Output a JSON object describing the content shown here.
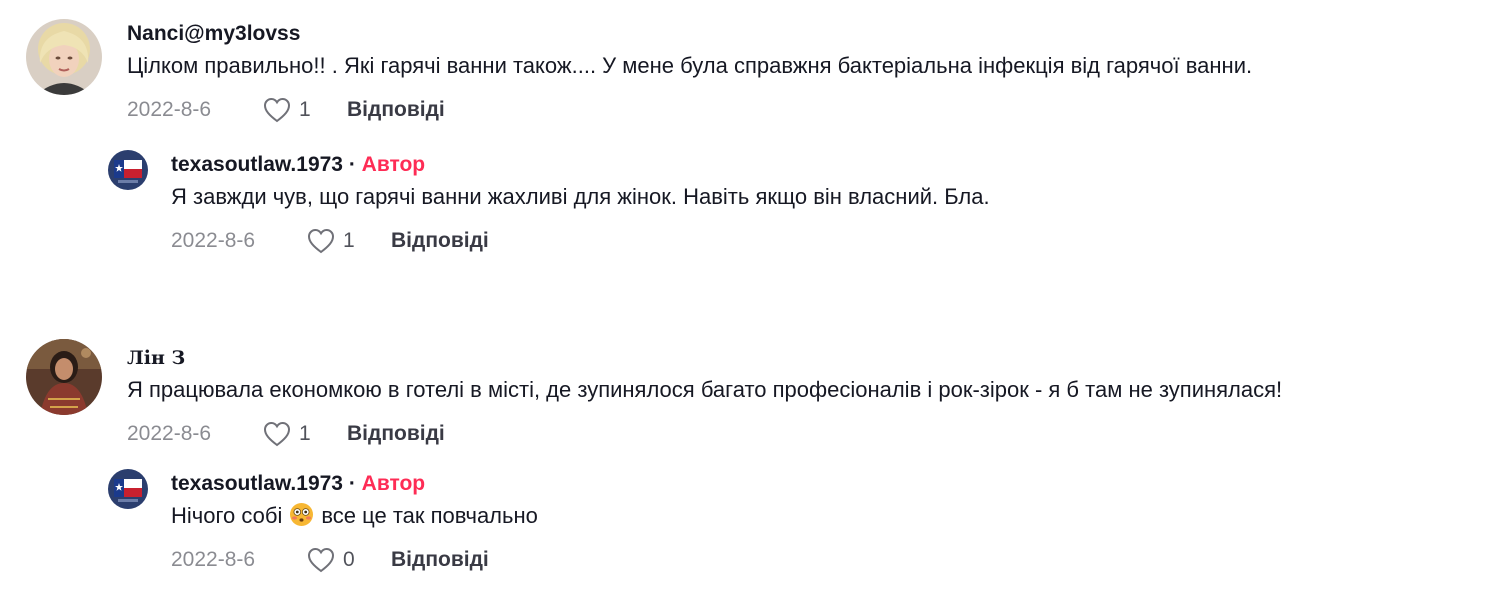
{
  "comments": [
    {
      "username": "Nanci@my3lovss",
      "text": "Цілком правильно!! . Які гарячі ванни також.... У мене була справжня бактеріальна інфекція від гарячої ванни.",
      "date": "2022-8-6",
      "likes": "1",
      "reply_label": "Відповіді",
      "avatar_icon": "avatar-woman-blonde",
      "reply": {
        "username": "texasoutlaw.1973",
        "separator": " · ",
        "author_tag": "Автор",
        "text": "Я завжди чув, що гарячі ванни жахливі для жінок. Навіть якщо він власний. Бла.",
        "date": "2022-8-6",
        "likes": "1",
        "reply_label": "Відповіді",
        "avatar_icon": "avatar-texas-flag"
      }
    },
    {
      "username": "Лін З",
      "text": "Я працювала економкою в готелі в місті, де зупинялося багато професіоналів і рок-зірок - я б там не зупинялася!",
      "date": "2022-8-6",
      "likes": "1",
      "reply_label": "Відповіді",
      "avatar_icon": "avatar-woman-dark",
      "reply": {
        "username": "texasoutlaw.1973",
        "separator": " · ",
        "author_tag": "Автор",
        "text_before": "Нічого собі",
        "emoji": "flushed-face-emoji",
        "text_after": "все це так повчально",
        "date": "2022-8-6",
        "likes": "0",
        "reply_label": "Відповіді",
        "avatar_icon": "avatar-texas-flag"
      }
    }
  ],
  "colors": {
    "author_tag": "#fe2c55",
    "text": "#161823",
    "muted": "#8a8b91"
  }
}
